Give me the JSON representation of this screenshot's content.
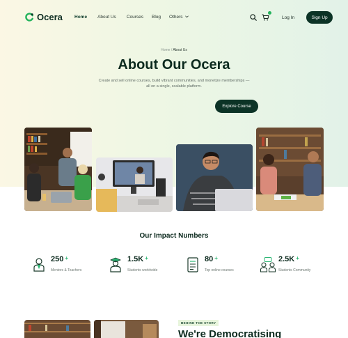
{
  "brand": {
    "name": "Ocera",
    "accent": "#24b35c",
    "dark": "#0c3326"
  },
  "nav": {
    "items": [
      {
        "label": "Home",
        "active": true
      },
      {
        "label": "About Us"
      },
      {
        "label": "Courses"
      },
      {
        "label": "Blog"
      },
      {
        "label": "Others"
      }
    ],
    "login_label": "Log In",
    "signup_label": "Sign Up",
    "icons": [
      "search-icon",
      "cart-icon",
      "chevron-down-icon"
    ]
  },
  "hero": {
    "breadcrumb": {
      "home": "Home",
      "separator": "/",
      "current": "About Us"
    },
    "title": "About Our Ocera",
    "subtitle": "Create and sell online courses, build vibrant communities, and monetize memberships — all on a single, scalable platform.",
    "cta_label": "Explore Course"
  },
  "impact": {
    "title": "Our Impact Numbers",
    "stats": [
      {
        "value": "250",
        "suffix": "+",
        "label": "Mentors & Teachers",
        "icon": "mentor-icon"
      },
      {
        "value": "1.5K",
        "suffix": "+",
        "label": "Students worldwide",
        "icon": "student-icon"
      },
      {
        "value": "80",
        "suffix": "+",
        "label": "Top online courses",
        "icon": "book-icon"
      },
      {
        "value": "2.5K",
        "suffix": "+",
        "label": "Students Community",
        "icon": "community-icon"
      }
    ]
  },
  "story": {
    "tag": "BEHIND THE STORY",
    "title": "We're Democratising"
  }
}
